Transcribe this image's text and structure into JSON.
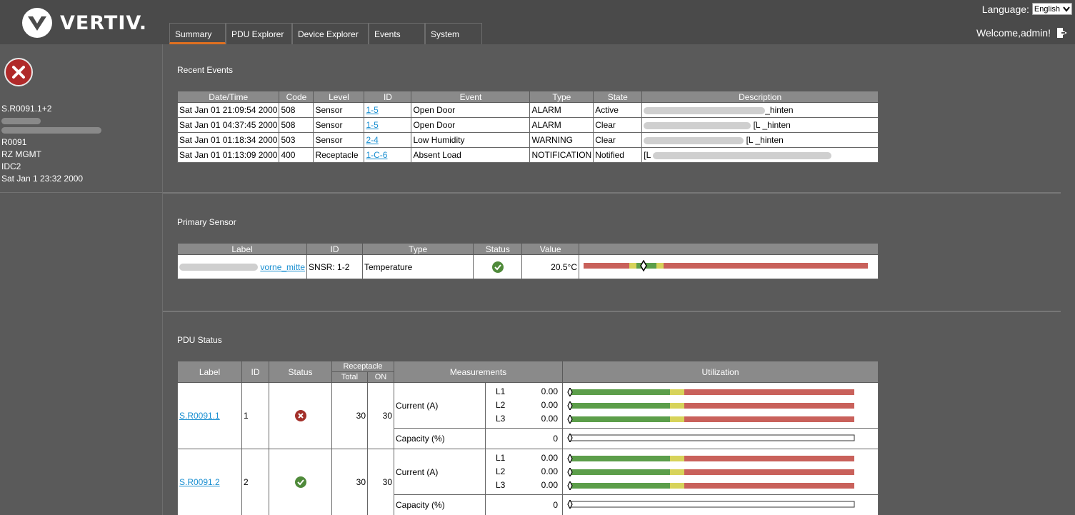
{
  "header": {
    "logo_text": "VERTIV.",
    "language_label": "Language:",
    "language_value": "English",
    "welcome_text": "Welcome,admin!"
  },
  "tabs": [
    {
      "label": "Summary",
      "active": true
    },
    {
      "label": "PDU Explorer",
      "active": false
    },
    {
      "label": "Device Explorer",
      "active": false
    },
    {
      "label": "Events",
      "active": false
    },
    {
      "label": "System",
      "active": false
    }
  ],
  "sidebar": {
    "device_name": "S.R0091.1+2",
    "lines": [
      "R0091",
      "RZ MGMT",
      "IDC2",
      "Sat Jan 1 23:32 2000"
    ]
  },
  "recent_events": {
    "title": "Recent Events",
    "headers": [
      "Date/Time",
      "Code",
      "Level",
      "ID",
      "Event",
      "Type",
      "State",
      "Description"
    ],
    "rows": [
      {
        "datetime": "Sat Jan 01 21:09:54 2000",
        "code": "508",
        "level": "Sensor",
        "id": "1-5",
        "event": "Open Door",
        "type": "ALARM",
        "state": "Active",
        "desc": "_hinten"
      },
      {
        "datetime": "Sat Jan 01 04:37:45 2000",
        "code": "508",
        "level": "Sensor",
        "id": "1-5",
        "event": "Open Door",
        "type": "ALARM",
        "state": "Clear",
        "desc": "[L _hinten"
      },
      {
        "datetime": "Sat Jan 01 01:18:34 2000",
        "code": "503",
        "level": "Sensor",
        "id": "2-4",
        "event": "Low Humidity",
        "type": "WARNING",
        "state": "Clear",
        "desc": "[L _hinten"
      },
      {
        "datetime": "Sat Jan 01 01:13:09 2000",
        "code": "400",
        "level": "Receptacle",
        "id": "1-C-6",
        "event": "Absent Load",
        "type": "NOTIFICATION",
        "state": "Notified",
        "desc": "[L"
      }
    ]
  },
  "primary_sensor": {
    "title": "Primary Sensor",
    "headers": [
      "Label",
      "ID",
      "Type",
      "Status",
      "Value"
    ],
    "row": {
      "label": "vorne_mitte",
      "id": "SNSR: 1-2",
      "type": "Temperature",
      "status": "ok",
      "value": "20.5°C"
    }
  },
  "pdu_status": {
    "title": "PDU Status",
    "headers": {
      "label": "Label",
      "id": "ID",
      "status": "Status",
      "receptacle": "Receptacle",
      "total": "Total",
      "on": "ON",
      "measurements": "Measurements",
      "utilization": "Utilization"
    },
    "current_label": "Current (A)",
    "capacity_label": "Capacity (%)",
    "pdus": [
      {
        "label": "S.R0091.1",
        "id": "1",
        "status": "error",
        "total": "30",
        "on": "30",
        "phases": [
          {
            "name": "L1",
            "value": "0.00"
          },
          {
            "name": "L2",
            "value": "0.00"
          },
          {
            "name": "L3",
            "value": "0.00"
          }
        ],
        "capacity": "0"
      },
      {
        "label": "S.R0091.2",
        "id": "2",
        "status": "ok",
        "total": "30",
        "on": "30",
        "phases": [
          {
            "name": "L1",
            "value": "0.00"
          },
          {
            "name": "L2",
            "value": "0.00"
          },
          {
            "name": "L3",
            "value": "0.00"
          }
        ],
        "capacity": "0"
      }
    ]
  },
  "colors": {
    "gauge_red": "#c9615b",
    "gauge_green": "#5c9e4a",
    "gauge_yellow": "#d7d35a",
    "accent": "#e07020"
  }
}
